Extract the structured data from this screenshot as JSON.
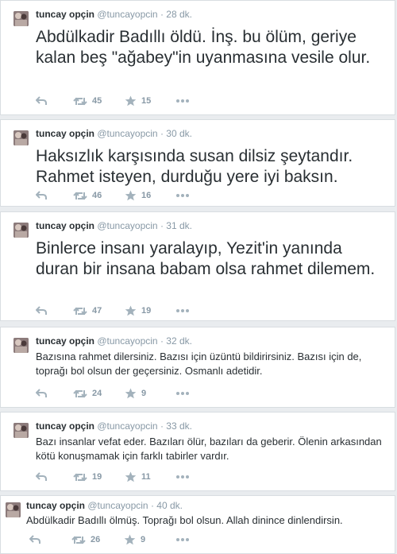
{
  "colors": {
    "icon": "#a3b2bc",
    "muted": "#8899a6",
    "text": "#292f33"
  },
  "icons": {
    "reply": "reply-icon",
    "retweet": "retweet-icon",
    "favorite": "star-icon",
    "more": "more-dots-icon"
  },
  "tweets": [
    {
      "name": "tuncay opçin",
      "handle": "@tuncayopcin",
      "sep": "·",
      "time": "28 dk.",
      "text": "Abdülkadir Badıllı öldü. İnş. bu ölüm, geriye kalan beş \"ağabey\"in uyanmasına vesile olur.",
      "retweets": "45",
      "favorites": "15"
    },
    {
      "name": "tuncay opçin",
      "handle": "@tuncayopcin",
      "sep": "·",
      "time": "30 dk.",
      "text": "Haksızlık karşısında susan dilsiz şeytandır. Rahmet isteyen, durduğu yere iyi baksın.",
      "retweets": "46",
      "favorites": "16"
    },
    {
      "name": "tuncay opçin",
      "handle": "@tuncayopcin",
      "sep": "·",
      "time": "31 dk.",
      "text": "Binlerce insanı yaralayıp, Yezit'in yanında duran bir insana babam olsa rahmet dilemem.",
      "retweets": "47",
      "favorites": "19"
    },
    {
      "name": "tuncay opçin",
      "handle": "@tuncayopcin",
      "sep": "·",
      "time": "32 dk.",
      "text": "Bazısına rahmet dilersiniz. Bazısı için üzüntü bildirirsiniz. Bazısı için de, toprağı bol olsun der geçersiniz. Osmanlı adetidir.",
      "retweets": "24",
      "favorites": "9"
    },
    {
      "name": "tuncay opçin",
      "handle": "@tuncayopcin",
      "sep": "·",
      "time": "33 dk.",
      "text": "Bazı insanlar vefat eder. Bazıları ölür, bazıları da geberir. Ölenin arkasından kötü konuşmamak için farklı tabirler vardır.",
      "retweets": "19",
      "favorites": "11"
    },
    {
      "name": "tuncay opçin",
      "handle": "@tuncayopcin",
      "sep": "·",
      "time": "40 dk.",
      "text": "Abdülkadir Badıllı ölmüş. Toprağı bol olsun. Allah dinince dinlendirsin.",
      "retweets": "26",
      "favorites": "9"
    }
  ]
}
